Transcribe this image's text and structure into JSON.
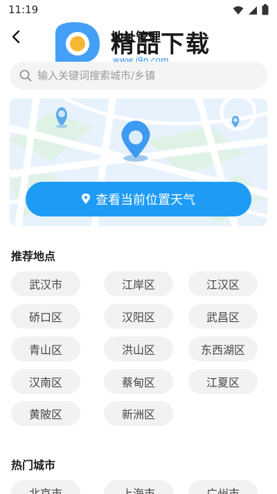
{
  "status": {
    "time": "11:19"
  },
  "header": {
    "title": "地址管理"
  },
  "watermark": {
    "brand": "精品下载",
    "url": "www.j9p.com"
  },
  "search": {
    "placeholder": "输入关键词搜索城市/乡镇"
  },
  "map": {
    "locate_label": "查看当前位置天气"
  },
  "recommended": {
    "title": "推荐地点",
    "places": [
      "武汉市",
      "江岸区",
      "江汉区",
      "硚口区",
      "汉阳区",
      "武昌区",
      "青山区",
      "洪山区",
      "东西湖区",
      "汉南区",
      "蔡甸区",
      "江夏区",
      "黄陂区",
      "新洲区"
    ]
  },
  "hot": {
    "title": "热门城市",
    "cities": [
      "北京市",
      "上海市",
      "广州市"
    ]
  },
  "colors": {
    "accent": "#1e9bf5",
    "chip_bg": "#f1f2f4"
  }
}
